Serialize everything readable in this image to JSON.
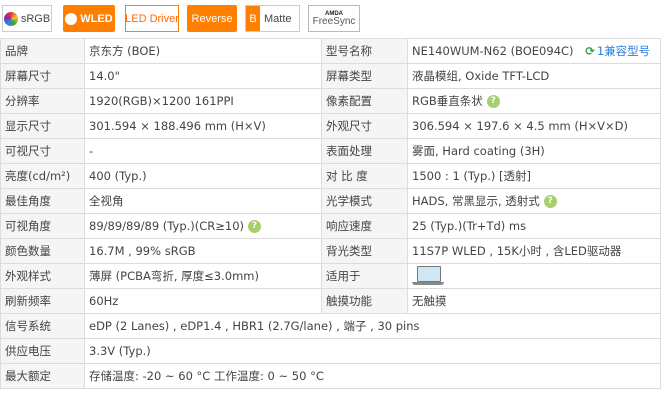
{
  "badges": {
    "srgb": "sRGB",
    "wled": "WLED",
    "led_driver": "LED Driver",
    "reverse": "Reverse",
    "matte_mark": "B",
    "matte": "Matte",
    "freesync_brand": "AMDA",
    "freesync": "FreeSync"
  },
  "colors": {
    "accent": "#ff7f00",
    "help_badge": "#a6cf6e",
    "link": "#2b7de0",
    "label_bg": "#f5f5f5",
    "border": "#dcdcdc"
  },
  "icons": {
    "help": "question-circle-icon",
    "compat": "refresh-icon",
    "touch": "laptop-icon"
  },
  "spec": {
    "brand": {
      "label": "品牌",
      "value": "京东方 (BOE)"
    },
    "model": {
      "label": "型号名称",
      "value": "NE140WUM-N62 (BOE094C)",
      "compat": "1兼容型号",
      "compat_icon": "⟳"
    },
    "size": {
      "label": "屏幕尺寸",
      "value": "14.0\""
    },
    "type": {
      "label": "屏幕类型",
      "value": "液晶模组,   Oxide TFT-LCD"
    },
    "resolution": {
      "label": "分辨率",
      "value": "1920(RGB)×1200   161PPI"
    },
    "pixel": {
      "label": "像素配置",
      "value": "RGB垂直条状"
    },
    "display_area": {
      "label": "显示尺寸",
      "value": "301.594 × 188.496 mm (H×V)"
    },
    "outline": {
      "label": "外观尺寸",
      "value": "306.594 × 197.6 × 4.5 mm (H×V×D)"
    },
    "viewable": {
      "label": "可视尺寸",
      "value": "-"
    },
    "surface": {
      "label": "表面处理",
      "value": "雾面,  Hard coating (3H)"
    },
    "brightness": {
      "label": "亮度(cd/m²)",
      "value": "400 (Typ.)"
    },
    "contrast": {
      "label": "对 比 度",
      "value": "1500 : 1 (Typ.) [透射]"
    },
    "best_view": {
      "label": "最佳角度",
      "value": "全视角"
    },
    "optical": {
      "label": "光学模式",
      "value": "HADS, 常黑显示, 透射式"
    },
    "view_angle": {
      "label": "可视角度",
      "value": "89/89/89/89 (Typ.)(CR≥10)"
    },
    "response": {
      "label": "响应速度",
      "value": "25 (Typ.)(Tr+Td) ms"
    },
    "colors_count": {
      "label": "颜色数量",
      "value": "16.7M ,  99% sRGB"
    },
    "backlight": {
      "label": "背光类型",
      "value": "11S7P WLED , 15K小时 , 含LED驱动器"
    },
    "style": {
      "label": "外观样式",
      "value": "薄屏 (PCBA弯折, 厚度≤3.0mm)"
    },
    "usage": {
      "label": "适用于"
    },
    "refresh": {
      "label": "刷新频率",
      "value": "60Hz"
    },
    "touch": {
      "label": "触摸功能",
      "value": "无触摸"
    },
    "interface": {
      "label": "信号系统",
      "value": "eDP (2 Lanes) , eDP1.4 , HBR1 (2.7G/lane) , 端子 , 30 pins"
    },
    "power": {
      "label": "供应电压",
      "value": "3.3V (Typ.)"
    },
    "ratings": {
      "label": "最大额定",
      "value": "存储温度: -20 ~ 60 °C    工作温度: 0 ~ 50 °C"
    }
  }
}
